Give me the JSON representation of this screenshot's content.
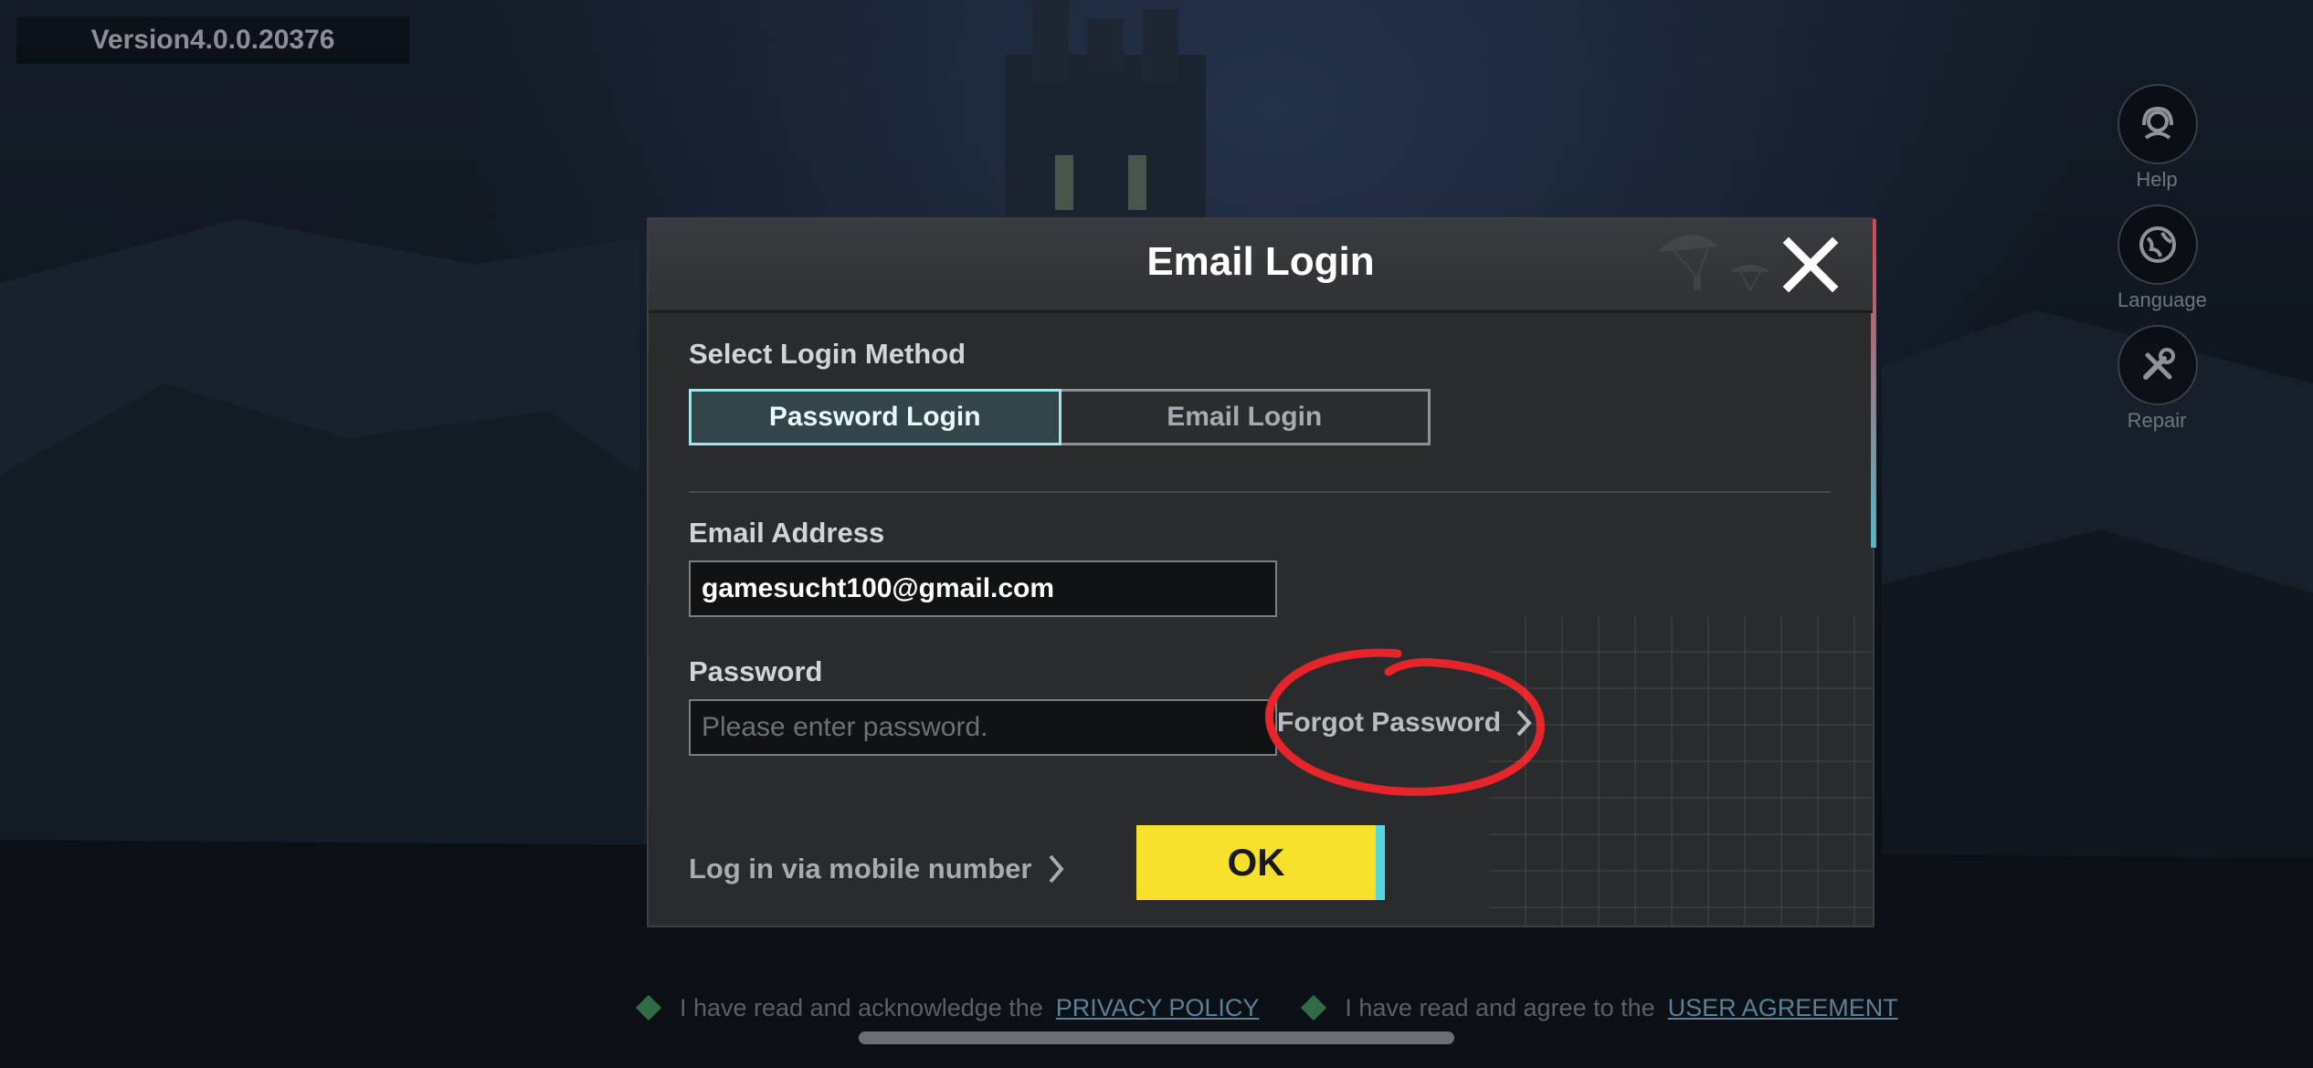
{
  "version": "Version4.0.0.20376",
  "side_menu": [
    {
      "label": "Help",
      "icon": "help-headset-icon"
    },
    {
      "label": "Language",
      "icon": "globe-icon"
    },
    {
      "label": "Repair",
      "icon": "wrench-screwdriver-icon"
    }
  ],
  "dialog": {
    "title": "Email Login",
    "close_icon": "close-icon",
    "select_method_label": "Select Login Method",
    "tabs": [
      {
        "label": "Password Login",
        "active": true
      },
      {
        "label": "Email Login",
        "active": false
      }
    ],
    "email": {
      "label": "Email Address",
      "value": "gamesucht100@gmail.com"
    },
    "password": {
      "label": "Password",
      "value": "",
      "placeholder": "Please enter password."
    },
    "forgot_password": "Forgot Password",
    "mobile_login": "Log in via mobile number",
    "ok_label": "OK"
  },
  "agreements": {
    "privacy_text": "I have read and acknowledge the",
    "privacy_link": "PRIVACY POLICY",
    "user_text": "I have read and agree to the",
    "user_link": "USER AGREEMENT"
  },
  "colors": {
    "accent_active_tab": "#9fe6ee",
    "ok_button": "#f7e02c",
    "annotation": "#e8242b"
  }
}
